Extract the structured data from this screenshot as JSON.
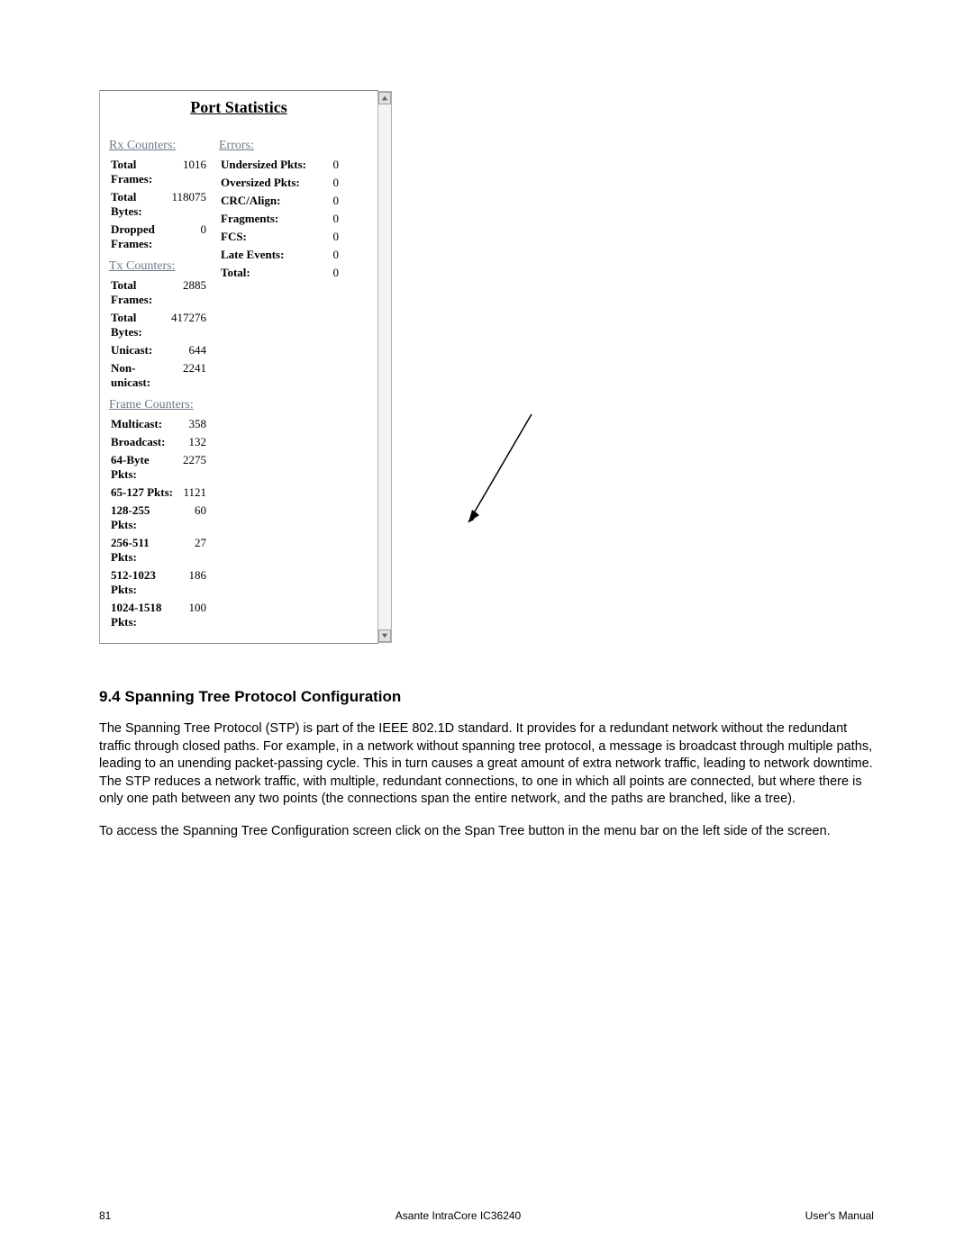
{
  "panel": {
    "title": "Port Statistics",
    "sections": {
      "rx_counters": "Rx Counters:",
      "tx_counters": "Tx Counters:",
      "frame_counters": "Frame Counters:",
      "errors": "Errors:"
    },
    "rx": [
      {
        "label": "Total Frames:",
        "value": "1016"
      },
      {
        "label": "Total Bytes:",
        "value": "118075"
      },
      {
        "label": "Dropped Frames:",
        "value": "0"
      }
    ],
    "tx": [
      {
        "label": "Total Frames:",
        "value": "2885"
      },
      {
        "label": "Total Bytes:",
        "value": "417276"
      },
      {
        "label": "Unicast:",
        "value": "644"
      },
      {
        "label": "Non-unicast:",
        "value": "2241"
      }
    ],
    "frame": [
      {
        "label": "Multicast:",
        "value": "358"
      },
      {
        "label": "Broadcast:",
        "value": "132"
      },
      {
        "label": "64-Byte Pkts:",
        "value": "2275"
      },
      {
        "label": "65-127 Pkts:",
        "value": "1121"
      },
      {
        "label": "128-255 Pkts:",
        "value": "60"
      },
      {
        "label": "256-511 Pkts:",
        "value": "27"
      },
      {
        "label": "512-1023 Pkts:",
        "value": "186"
      },
      {
        "label": "1024-1518 Pkts:",
        "value": "100"
      }
    ],
    "errors": [
      {
        "label": "Undersized Pkts:",
        "value": "0"
      },
      {
        "label": "Oversized Pkts:",
        "value": "0"
      },
      {
        "label": "CRC/Align:",
        "value": "0"
      },
      {
        "label": "Fragments:",
        "value": "0"
      },
      {
        "label": "FCS:",
        "value": "0"
      },
      {
        "label": "Late Events:",
        "value": "0"
      },
      {
        "label": "Total:",
        "value": "0"
      }
    ]
  },
  "section": {
    "heading": "9.4 Spanning Tree Protocol Configuration",
    "paragraph1": "The Spanning Tree Protocol (STP) is part of the IEEE 802.1D standard. It provides for a redundant network without the redundant traffic through closed paths. For example, in a network without spanning tree protocol, a message is broadcast through multiple paths, leading to an unending packet-passing cycle. This in turn causes a great amount of extra network traffic, leading to network downtime. The STP reduces a network traffic, with multiple, redundant connections, to one in which all points are connected, but where there is only one path between any two points (the connections span the entire network, and the paths are branched, like a tree).",
    "paragraph2": "To access the Spanning Tree Configuration screen click on the Span Tree button in the menu bar on the left side of the screen."
  },
  "footer": {
    "page": "81",
    "center": "Asante IntraCore IC36240",
    "right": "User's Manual"
  }
}
